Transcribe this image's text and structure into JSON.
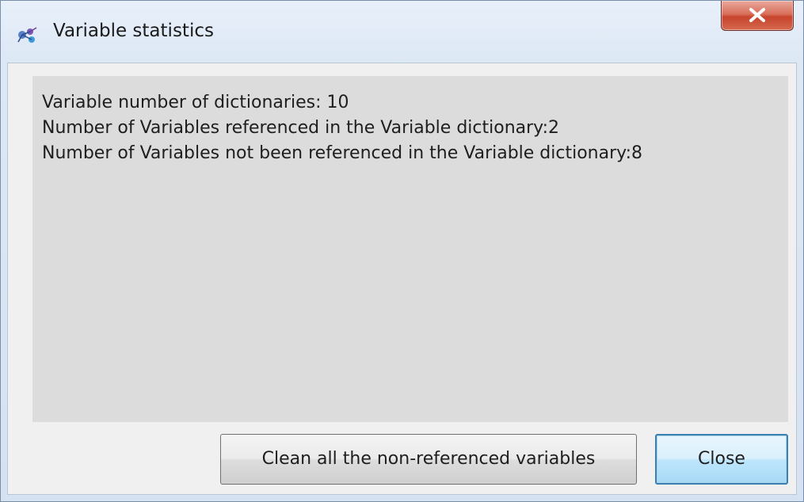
{
  "window": {
    "title": "Variable statistics"
  },
  "titlebar": {
    "app_icon": "variable-app-icon",
    "close_icon": "close-icon"
  },
  "stats": {
    "lines": [
      "Variable number of dictionaries: 10",
      "Number of Variables referenced in the Variable dictionary:2",
      "Number of Variables not been referenced in the Variable dictionary:8"
    ]
  },
  "buttons": {
    "clean_label": "Clean all the non-referenced variables",
    "close_label": "Close"
  },
  "colors": {
    "panel_background": "#dcdcdc",
    "close_button_accent": "#c7432c",
    "default_button_border": "#3c7fb1"
  }
}
